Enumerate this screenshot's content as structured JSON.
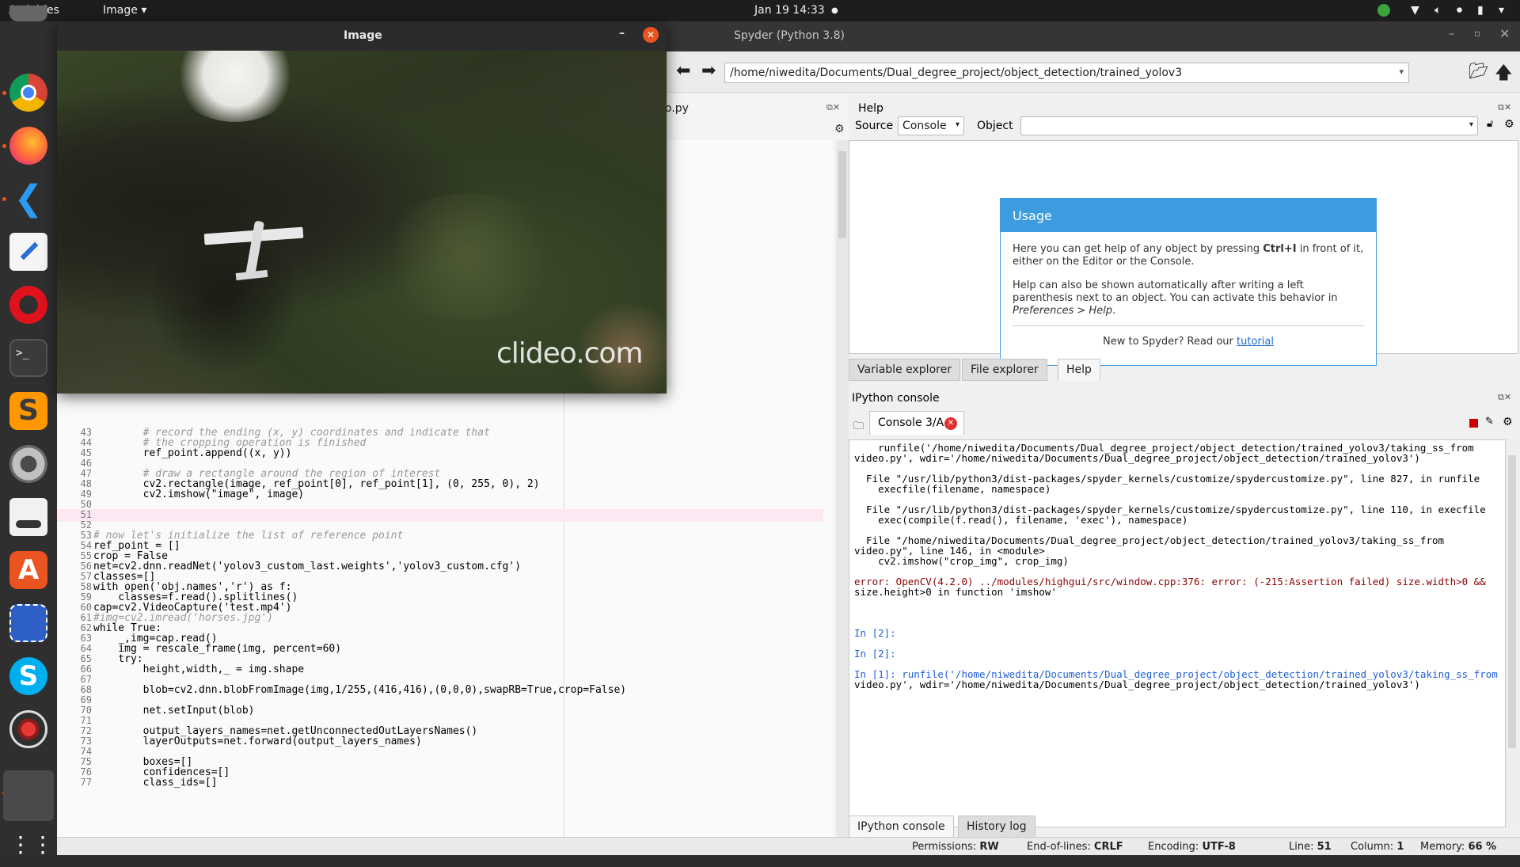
{
  "topbar": {
    "activities": "Activities",
    "app_menu": "Image",
    "datetime": "Jan 19  14:33"
  },
  "spyder": {
    "window_title": "Spyder (Python 3.8)",
    "path": "/home/niwedita/Documents/Dual_degree_project/object_detection/trained_yolov3",
    "editor_tab": "o.py"
  },
  "help": {
    "title": "Help",
    "source_label": "Source",
    "source_value": "Console",
    "object_label": "Object",
    "usage_title": "Usage",
    "usage_p1a": "Here you can get help of any object by pressing ",
    "usage_p1b": "Ctrl+I",
    "usage_p1c": " in front of it, either on the Editor or the Console.",
    "usage_p2a": "Help can also be shown automatically after writing a left parenthesis next to an object. You can activate this behavior in ",
    "usage_p2b": "Preferences > Help",
    "usage_p3a": "New to Spyder? Read our ",
    "usage_p3b": "tutorial"
  },
  "upper_tabs": [
    "Variable explorer",
    "File explorer",
    "Help"
  ],
  "console": {
    "title": "IPython console",
    "tab": "Console 3/A",
    "lines": [
      "    runfile('/home/niwedita/Documents/Dual_degree_project/object_detection/trained_yolov3/taking_ss_from",
      "video.py', wdir='/home/niwedita/Documents/Dual_degree_project/object_detection/trained_yolov3')",
      "",
      "  File \"/usr/lib/python3/dist-packages/spyder_kernels/customize/spydercustomize.py\", line 827, in runfile",
      "    execfile(filename, namespace)",
      "",
      "  File \"/usr/lib/python3/dist-packages/spyder_kernels/customize/spydercustomize.py\", line 110, in execfile",
      "    exec(compile(f.read(), filename, 'exec'), namespace)",
      "",
      "  File \"/home/niwedita/Documents/Dual_degree_project/object_detection/trained_yolov3/taking_ss_from",
      "video.py\", line 146, in <module>",
      "    cv2.imshow(\"crop_img\", crop_img)",
      "",
      "error: OpenCV(4.2.0) ../modules/highgui/src/window.cpp:376: error: (-215:Assertion failed) size.width>0 &&",
      "size.height>0 in function 'imshow'",
      "",
      "",
      "",
      "In [2]:",
      "",
      "In [2]:",
      "",
      "In [1]: runfile('/home/niwedita/Documents/Dual_degree_project/object_detection/trained_yolov3/taking_ss_from",
      "video.py', wdir='/home/niwedita/Documents/Dual_degree_project/object_detection/trained_yolov3')"
    ]
  },
  "lower_tabs": [
    "IPython console",
    "History log"
  ],
  "status": {
    "perm_label": "Permissions:",
    "perm": "RW",
    "eol_label": "End-of-lines:",
    "eol": "CRLF",
    "enc_label": "Encoding:",
    "enc": "UTF-8",
    "line_label": "Line:",
    "line": "51",
    "col_label": "Column:",
    "col": "1",
    "mem_label": "Memory:",
    "mem": "66 %"
  },
  "image_window": {
    "title": "Image",
    "watermark": "clideo.com"
  },
  "code_lines": [
    {
      "n": "43",
      "t": "        # record the ending (x, y) coordinates and indicate that"
    },
    {
      "n": "44",
      "t": "        # the cropping operation is finished"
    },
    {
      "n": "45",
      "t": "        ref_point.append((x, y))"
    },
    {
      "n": "46",
      "t": ""
    },
    {
      "n": "47",
      "t": "        # draw a rectangle around the region of interest"
    },
    {
      "n": "48",
      "t": "        cv2.rectangle(image, ref_point[0], ref_point[1], (0, 255, 0), 2)"
    },
    {
      "n": "49",
      "t": "        cv2.imshow(\"image\", image)"
    },
    {
      "n": "50",
      "t": ""
    },
    {
      "n": "51",
      "t": ""
    },
    {
      "n": "52",
      "t": ""
    },
    {
      "n": "53",
      "t": "# now let's initialize the list of reference point"
    },
    {
      "n": "54",
      "t": "ref_point = []"
    },
    {
      "n": "55",
      "t": "crop = False"
    },
    {
      "n": "56",
      "t": "net=cv2.dnn.readNet('yolov3_custom_last.weights','yolov3_custom.cfg')"
    },
    {
      "n": "57",
      "t": "classes=[]"
    },
    {
      "n": "58",
      "t": "with open('obj.names','r') as f:"
    },
    {
      "n": "59",
      "t": "    classes=f.read().splitlines()"
    },
    {
      "n": "60",
      "t": "cap=cv2.VideoCapture('test.mp4')"
    },
    {
      "n": "61",
      "t": "#img=cv2.imread('horses.jpg')"
    },
    {
      "n": "62",
      "t": "while True:"
    },
    {
      "n": "63",
      "t": "    _,img=cap.read()"
    },
    {
      "n": "64",
      "t": "    img = rescale_frame(img, percent=60)"
    },
    {
      "n": "65",
      "t": "    try:"
    },
    {
      "n": "66",
      "t": "        height,width,_ = img.shape"
    },
    {
      "n": "67",
      "t": ""
    },
    {
      "n": "68",
      "t": "        blob=cv2.dnn.blobFromImage(img,1/255,(416,416),(0,0,0),swapRB=True,crop=False)"
    },
    {
      "n": "69",
      "t": ""
    },
    {
      "n": "70",
      "t": "        net.setInput(blob)"
    },
    {
      "n": "71",
      "t": ""
    },
    {
      "n": "72",
      "t": "        output_layers_names=net.getUnconnectedOutLayersNames()"
    },
    {
      "n": "73",
      "t": "        layerOutputs=net.forward(output_layers_names)"
    },
    {
      "n": "74",
      "t": ""
    },
    {
      "n": "75",
      "t": "        boxes=[]"
    },
    {
      "n": "76",
      "t": "        confidences=[]"
    },
    {
      "n": "77",
      "t": "        class_ids=[]"
    }
  ]
}
